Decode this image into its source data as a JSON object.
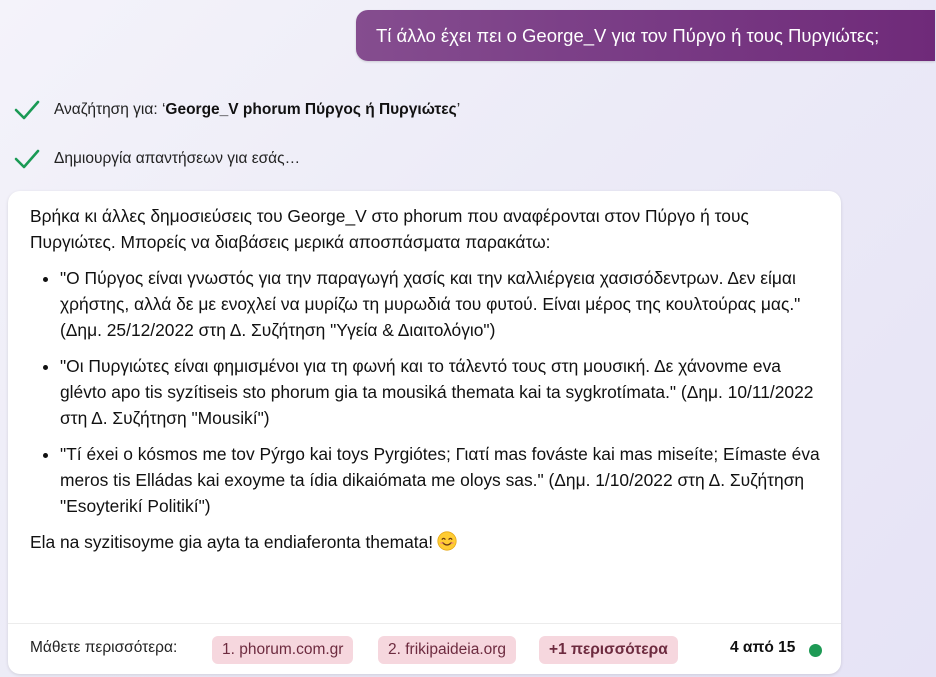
{
  "user_message": "Τί άλλο έχει πει ο George_V για τον Πύργο ή τους Πυργιώτες;",
  "status": {
    "search_prefix": "Αναζήτηση για: ‘",
    "search_query": "George_V phorum Πύργος ή Πυργιώτες",
    "search_suffix": "’",
    "generating": "Δημιουργία απαντήσεων για εσάς…"
  },
  "answer": {
    "intro": "Βρήκα κι άλλες δημοσιεύσεις του George_V στο phorum που αναφέρονται στον Πύργο ή τους Πυργιώτες. Μπορείς να διαβάσεις μερικά αποσπάσματα παρακάτω:",
    "quotes": [
      "\"Ο Πύργος είναι γνωστός για την παραγωγή χασίς και την καλλιέργεια χασισόδεντρων. Δεν είμαι χρήστης, αλλά δε με ενοχλεί να μυρίζω τη μυρωδιά του φυτού. Είναι μέρος της κουλτούρας μας.\" (Δημ. 25/12/2022 στη Δ. Συζήτηση \"Υγεία & Διαιτολόγιο\")",
      "\"Οι Πυργιώτες είναι φημισμένοι για τη φωνή και το τάλεντό τους στη μουσική. Δε χάνονme eva glévto apo tis syzítiseis sto phorum gia ta mousiká themata kai ta sygkrotímata.\" (Δημ. 10/11/2022 στη Δ. Συζήτηση \"Mousikí\")",
      "\"Tí éxei o kósmos me tov Pýrgo kai toys Pyrgiótes; Γιατί mas fováste kai mas miseíte; Eímaste éva meros tis Elládas kai exoyme ta ídia dikaiómata me oloys sas.\" (Δημ. 1/10/2022 στη Δ. Συζήτηση \"Esoyterikí Politikí\")"
    ],
    "closing": "Ela na syzitisoyme gia ayta ta endiaferonta themata!",
    "emoji_icon": "smiling-face-icon"
  },
  "footer": {
    "learn_more_label": "Μάθετε περισσότερα:",
    "sources": [
      "1. phorum.com.gr",
      "2. frikipaideia.org"
    ],
    "more_label": "+1 περισσότερα",
    "counter": "4 από 15",
    "status_color": "#1e9a55"
  },
  "colors": {
    "user_bubble": "#7a3d86",
    "check": "#1a9a55",
    "chip_bg": "#f6d7de"
  }
}
